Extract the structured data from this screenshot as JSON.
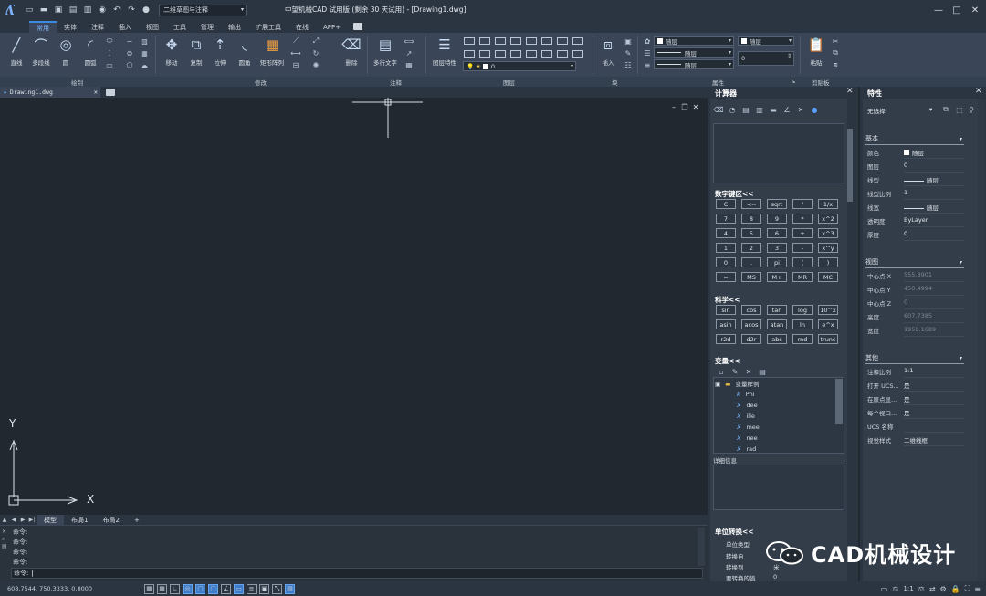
{
  "titlebar": {
    "workspace": "二维草图与注释",
    "title": "中望机械CAD 试用版 (剩余 30 天试用) - [Drawing1.dwg]",
    "minimize": "—",
    "maximize": "□",
    "close": "✕"
  },
  "ribbon_tabs": [
    "常用",
    "实体",
    "注释",
    "插入",
    "视图",
    "工具",
    "管理",
    "输出",
    "扩展工具",
    "在线",
    "APP+"
  ],
  "ribbon": {
    "draw": [
      "直线",
      "多段线",
      "圆",
      "圆弧"
    ],
    "modify": [
      "移动",
      "复制",
      "拉伸",
      "圆角",
      "矩形阵列",
      "删除"
    ],
    "annotation": [
      "多行文字"
    ],
    "layers": [
      "图层特性"
    ],
    "layer_combo": "0",
    "block": [
      "插入"
    ],
    "props": {
      "color": "随层",
      "linetype": "随层",
      "lineweight": "随层",
      "plotstyle": "随层",
      "thickness": "0"
    },
    "clipboard": [
      "粘贴"
    ]
  },
  "ribbon_groups": {
    "draw": "绘制",
    "modify": "修改",
    "annotation": "注释",
    "layers": "图层",
    "block": "块",
    "props": "属性",
    "clipboard": "剪贴板"
  },
  "doc_tab": "Drawing1.dwg",
  "canvas_ucs": {
    "x": "X",
    "y": "Y"
  },
  "layout_tabs": [
    "模型",
    "布局1",
    "布局2",
    "+"
  ],
  "command": {
    "lines": [
      "命令:",
      "命令:",
      "命令:",
      "命令:"
    ],
    "prompt": "命令:"
  },
  "status": {
    "coords": "608.7544,  750.3333,  0.0000",
    "scale": "1:1"
  },
  "calculator": {
    "title": "计算器",
    "numpad_title": "数字键区<<",
    "numpad": [
      [
        "C",
        "<--",
        "sqrt",
        "/",
        "1/x"
      ],
      [
        "7",
        "8",
        "9",
        "*",
        "x^2"
      ],
      [
        "4",
        "5",
        "6",
        "+",
        "x^3"
      ],
      [
        "1",
        "2",
        "3",
        "-",
        "x^y"
      ],
      [
        "0",
        ".",
        "pi",
        "(",
        ")"
      ],
      [
        "=",
        "MS",
        "M+",
        "MR",
        "MC"
      ]
    ],
    "sci_title": "科学<<",
    "sci": [
      [
        "sin",
        "cos",
        "tan",
        "log",
        "10^x"
      ],
      [
        "asin",
        "acos",
        "atan",
        "ln",
        "e^x"
      ],
      [
        "r2d",
        "d2r",
        "abs",
        "rnd",
        "trunc"
      ]
    ],
    "vars_title": "变量<<",
    "vars_group": "变量样例",
    "vars": [
      "Phi",
      "dee",
      "ille",
      "mee",
      "nee",
      "rad"
    ],
    "detail_label": "详细信息",
    "unit_title": "单位转换<<",
    "unit_rows": [
      {
        "label": "单位类型",
        "value": ""
      },
      {
        "label": "转换自",
        "value": ""
      },
      {
        "label": "转换到",
        "value": "米"
      },
      {
        "label": "要转换的值",
        "value": "0"
      }
    ]
  },
  "properties": {
    "title": "特性",
    "selector": "无选择",
    "sections": [
      {
        "name": "基本",
        "rows": [
          {
            "k": "颜色",
            "v": "随层",
            "swatch": true
          },
          {
            "k": "图层",
            "v": "0"
          },
          {
            "k": "线型",
            "v": "随层",
            "line": true
          },
          {
            "k": "线型比例",
            "v": "1"
          },
          {
            "k": "线宽",
            "v": "随层",
            "line": true
          },
          {
            "k": "透明度",
            "v": "ByLayer"
          },
          {
            "k": "厚度",
            "v": "0"
          }
        ]
      },
      {
        "name": "视图",
        "rows": [
          {
            "k": "中心点 X",
            "v": "555.8901",
            "dim": true
          },
          {
            "k": "中心点 Y",
            "v": "450.4994",
            "dim": true
          },
          {
            "k": "中心点 Z",
            "v": "0",
            "dim": true
          },
          {
            "k": "高度",
            "v": "607.7385",
            "dim": true
          },
          {
            "k": "宽度",
            "v": "1959.1689",
            "dim": true
          }
        ]
      },
      {
        "name": "其他",
        "rows": [
          {
            "k": "注释比例",
            "v": "1:1"
          },
          {
            "k": "打开 UCS...",
            "v": "是"
          },
          {
            "k": "在原点显...",
            "v": "是"
          },
          {
            "k": "每个视口...",
            "v": "是"
          },
          {
            "k": "UCS 名称",
            "v": ""
          },
          {
            "k": "视觉样式",
            "v": "二维线框"
          }
        ]
      }
    ]
  },
  "watermark": "CAD机械设计"
}
